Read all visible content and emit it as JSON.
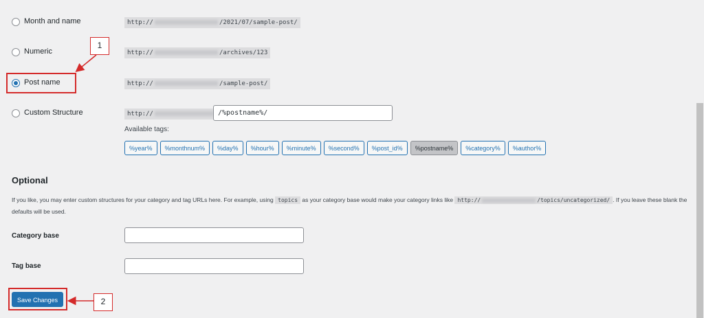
{
  "permalinks": {
    "options": [
      {
        "label": "Month and name",
        "url_prefix": "http://",
        "url_suffix": "/2021/07/sample-post/",
        "checked": false
      },
      {
        "label": "Numeric",
        "url_prefix": "http://",
        "url_suffix": "/archives/123",
        "checked": false
      },
      {
        "label": "Post name",
        "url_prefix": "http://",
        "url_suffix": "/sample-post/",
        "checked": true
      },
      {
        "label": "Custom Structure",
        "url_prefix": "http://",
        "url_suffix": "",
        "checked": false
      }
    ],
    "custom_structure_value": "/%postname%/",
    "available_tags_label": "Available tags:",
    "tags": [
      "%year%",
      "%monthnum%",
      "%day%",
      "%hour%",
      "%minute%",
      "%second%",
      "%post_id%",
      "%postname%",
      "%category%",
      "%author%"
    ],
    "active_tag": "%postname%"
  },
  "optional": {
    "title": "Optional",
    "desc_part1": "If you like, you may enter custom structures for your category and tag URLs here. For example, using ",
    "desc_code1": "topics",
    "desc_part2": " as your category base would make your category links like ",
    "desc_code2_prefix": "http://",
    "desc_code2_suffix": "/topics/uncategorized/",
    "desc_part3": ". If you leave these blank the defaults will be used.",
    "category_base_label": "Category base",
    "category_base_value": "",
    "tag_base_label": "Tag base",
    "tag_base_value": ""
  },
  "save_button_label": "Save Changes",
  "annotations": {
    "callout_1": "1",
    "callout_2": "2",
    "accent_color": "#d42a2a"
  },
  "colors": {
    "primary": "#2271b1",
    "background": "#f0f0f1"
  }
}
